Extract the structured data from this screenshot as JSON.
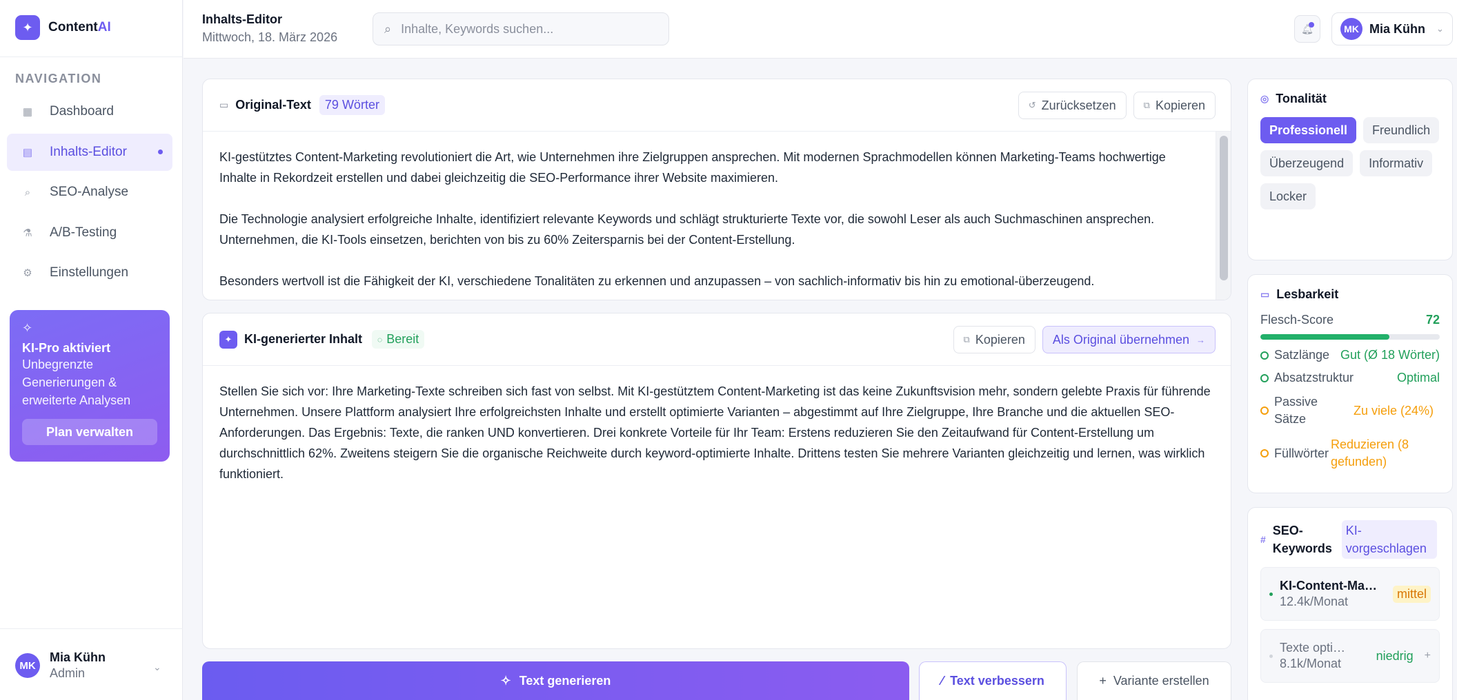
{
  "app": {
    "name_main": "Content",
    "name_accent": "AI"
  },
  "sidebar": {
    "heading": "NAVIGATION",
    "items": [
      {
        "label": "Dashboard",
        "icon": "grid-icon"
      },
      {
        "label": "Inhalts-Editor",
        "icon": "document-icon",
        "active": true
      },
      {
        "label": "SEO-Analyse",
        "icon": "search-icon"
      },
      {
        "label": "A/B-Testing",
        "icon": "flask-icon"
      },
      {
        "label": "Einstellungen",
        "icon": "gear-icon"
      }
    ],
    "promo": {
      "title": "KI-Pro aktiviert",
      "description": "Unbegrenzte Generierungen & erweiterte Analysen",
      "button": "Plan verwalten"
    },
    "user": {
      "initials": "MK",
      "name": "Mia Kühn",
      "role": "Admin"
    }
  },
  "header": {
    "title": "Inhalts-Editor",
    "date": "Mittwoch, 18. März 2026",
    "search_placeholder": "Inhalte, Keywords suchen...",
    "user": {
      "initials": "MK",
      "name": "Mia Kühn"
    }
  },
  "original": {
    "title": "Original-Text",
    "word_count": "79 Wörter",
    "reset_label": "Zurücksetzen",
    "copy_label": "Kopieren",
    "paragraphs": [
      "KI-gestütztes Content-Marketing revolutioniert die Art, wie Unternehmen ihre Zielgruppen ansprechen. Mit modernen Sprachmodellen können Marketing-Teams hochwertige Inhalte in Rekordzeit erstellen und dabei gleichzeitig die SEO-Performance ihrer Website maximieren.",
      "Die Technologie analysiert erfolgreiche Inhalte, identifiziert relevante Keywords und schlägt strukturierte Texte vor, die sowohl Leser als auch Suchmaschinen ansprechen. Unternehmen, die KI-Tools einsetzen, berichten von bis zu 60% Zeitersparnis bei der Content-Erstellung.",
      "Besonders wertvoll ist die Fähigkeit der KI, verschiedene Tonalitäten zu erkennen und anzupassen – von sachlich-informativ bis hin zu emotional-überzeugend."
    ]
  },
  "generated": {
    "title": "KI-generierter Inhalt",
    "status": "Bereit",
    "copy_label": "Kopieren",
    "adopt_label": "Als Original übernehmen",
    "text": "Stellen Sie sich vor: Ihre Marketing-Texte schreiben sich fast von selbst. Mit KI-gestütztem Content-Marketing ist das keine Zukunftsvision mehr, sondern gelebte Praxis für führende Unternehmen. Unsere Plattform analysiert Ihre erfolgreichsten Inhalte und erstellt optimierte Varianten – abgestimmt auf Ihre Zielgruppe, Ihre Branche und die aktuellen SEO-Anforderungen. Das Ergebnis: Texte, die ranken UND konvertieren. Drei konkrete Vorteile für Ihr Team: Erstens reduzieren Sie den Zeitaufwand für Content-Erstellung um durchschnittlich 62%. Zweitens steigern Sie die organische Reichweite durch keyword-optimierte Inhalte. Drittens testen Sie mehrere Varianten gleichzeitig und lernen, was wirklich funktioniert."
  },
  "actions": {
    "generate": "Text generieren",
    "improve": "Text verbessern",
    "variant": "Variante erstellen"
  },
  "tone": {
    "title": "Tonalität",
    "options": [
      "Professionell",
      "Freundlich",
      "Überzeugend",
      "Informativ",
      "Locker"
    ],
    "selected": "Professionell"
  },
  "readability": {
    "title": "Lesbarkeit",
    "flesch_label": "Flesch-Score",
    "flesch_score": 72,
    "metrics": [
      {
        "label": "Satzlänge",
        "value": "Gut (Ø 18 Wörter)",
        "status": "good"
      },
      {
        "label": "Absatzstruktur",
        "value": "Optimal",
        "status": "good"
      },
      {
        "label": "Passive Sätze",
        "value": "Zu viele (24%)",
        "status": "warn"
      },
      {
        "label": "Füllwörter",
        "value": "Reduzieren (8 gefunden)",
        "status": "warn"
      }
    ]
  },
  "seo": {
    "title": "SEO-Keywords",
    "badge": "KI-vorgeschlagen",
    "keywords": [
      {
        "name": "KI-Content-Marketing",
        "volume": "12.4k/Monat",
        "competition": "mittel"
      },
      {
        "name": "Texte optimieren",
        "volume": "8.1k/Monat",
        "competition": "niedrig"
      }
    ]
  },
  "colors": {
    "accent": "#6d5cf0",
    "good": "#22a05b",
    "warn": "#f59e0b"
  }
}
